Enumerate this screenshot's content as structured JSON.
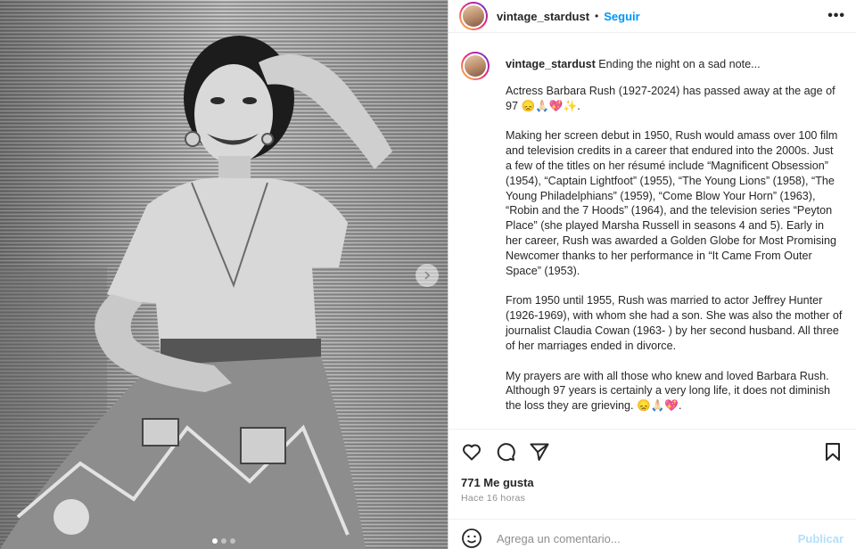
{
  "post_header": {
    "username": "vintage_stardust",
    "separator": "•",
    "follow_label": "Seguir",
    "more_label": "•••"
  },
  "caption": {
    "username": "vintage_stardust",
    "first_line": "Ending the night on a sad note...",
    "paragraphs": [
      "Actress Barbara Rush (1927-2024) has passed away at the age of 97 😞🙏🏻💖✨.",
      "Making her screen debut in 1950, Rush would amass over 100 film and television credits in a career that endured into the 2000s. Just a few of the titles on her résumé include “Magnificent Obsession” (1954), “Captain Lightfoot” (1955), “The Young Lions” (1958), “The Young Philadelphians” (1959), “Come Blow Your Horn” (1963), “Robin and the 7 Hoods” (1964), and the television series “Peyton Place” (she played Marsha Russell in seasons 4 and 5). Early in her career, Rush was awarded a Golden Globe for Most Promising Newcomer thanks to her performance in “It Came From Outer Space” (1953).",
      "From 1950 until 1955, Rush was married to actor Jeffrey Hunter (1926-1969), with whom she had a son. She was also the mother of journalist Claudia Cowan (1963- ) by her second husband. All three of her marriages ended in divorce.",
      "My prayers are with all those who knew and loved Barbara Rush. Although 97 years is certainly a very long life, it does not diminish the loss they are grieving. 😞🙏🏻💖."
    ]
  },
  "actions": {
    "icons": [
      "heart-icon",
      "comment-icon",
      "share-icon",
      "bookmark-icon"
    ]
  },
  "likes_text": "771 Me gusta",
  "time_text": "Hace 16 horas",
  "comment_box": {
    "placeholder": "Agrega un comentario...",
    "publish_label": "Publicar"
  },
  "carousel": {
    "slides": 3,
    "active": 0
  },
  "colors": {
    "accent": "#0095f6",
    "publish_disabled": "#b2dffc",
    "muted": "#8e8e8e"
  }
}
